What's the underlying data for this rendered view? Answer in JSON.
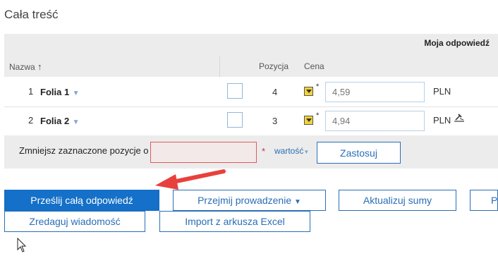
{
  "page": {
    "title": "Cała treść"
  },
  "table": {
    "group_header": "Moja odpowiedź",
    "columns": {
      "name": "Nazwa",
      "sort_icon": "↑",
      "position": "Pozycja",
      "price": "Cena"
    },
    "rows": [
      {
        "num": "1",
        "name": "Folia 1",
        "position": "4",
        "asterisk": "*",
        "price_placeholder": "4,59",
        "currency": "PLN"
      },
      {
        "num": "2",
        "name": "Folia 2",
        "position": "3",
        "asterisk": "*",
        "price_placeholder": "4,94",
        "currency": "PLN"
      }
    ]
  },
  "reduce": {
    "label": "Zmniejsz zaznaczone pozycje o",
    "required_mark": "*",
    "mode": "wartość",
    "apply_label": "Zastosuj"
  },
  "actions": {
    "submit_all": "Prześlij całą odpowiedź",
    "take_over": "Przejmij prowadzenie",
    "take_over_caret": "▼",
    "update_sums": "Aktualizuj sumy",
    "partial": "P",
    "edit_message": "Zredaguj wiadomość",
    "import_excel": "Import z arkusza Excel"
  },
  "colors": {
    "accent": "#1470c8",
    "error": "#e05a5a",
    "arrow": "#e8403c"
  }
}
